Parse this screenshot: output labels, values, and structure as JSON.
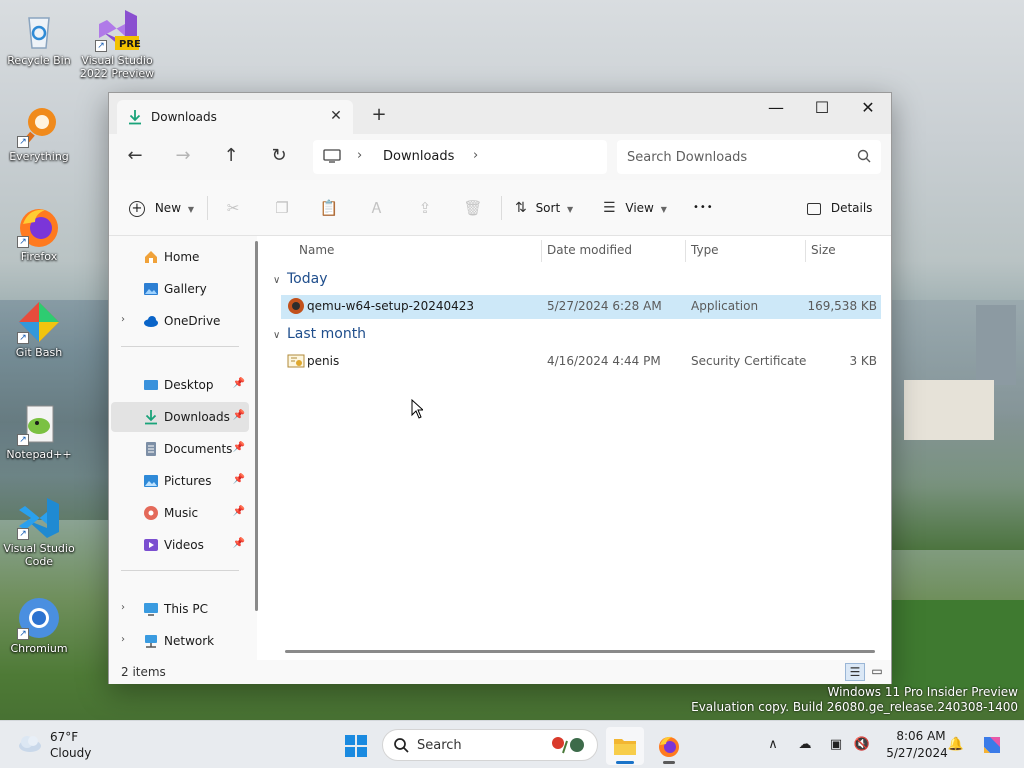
{
  "desktop": {
    "icons": [
      {
        "label": "Recycle Bin",
        "icon": "recycle-bin-icon"
      },
      {
        "label": "Visual Studio 2022 Preview",
        "line1": "Visual Studio",
        "line2": "2022 Preview",
        "badge": "PRE",
        "icon": "visual-studio-icon"
      },
      {
        "label": "Everything",
        "icon": "everything-search-icon"
      },
      {
        "label": "Firefox",
        "icon": "firefox-icon"
      },
      {
        "label": "Git Bash",
        "icon": "git-bash-icon"
      },
      {
        "label": "Notepad++",
        "icon": "notepad-plus-plus-icon"
      },
      {
        "label": "Visual Studio Code",
        "line1": "Visual Studio",
        "line2": "Code",
        "icon": "vscode-icon"
      },
      {
        "label": "Chromium",
        "icon": "chromium-icon"
      }
    ]
  },
  "window": {
    "tab": {
      "title": "Downloads",
      "close": "✕"
    },
    "new_tab": "+",
    "controls": {
      "minimize": "—",
      "maximize": "☐",
      "close": "✕"
    },
    "nav": {
      "back": "←",
      "forward": "→",
      "up": "↑",
      "refresh": "↻"
    },
    "address": {
      "path": "Downloads",
      "chevron": "›"
    },
    "search": {
      "placeholder": "Search Downloads"
    },
    "toolbar": {
      "new": "New",
      "sort": "Sort",
      "view": "View",
      "more": "•••",
      "details": "Details"
    },
    "sidebar": {
      "items": [
        {
          "label": "Home",
          "icon": "home-icon"
        },
        {
          "label": "Gallery",
          "icon": "gallery-icon"
        },
        {
          "label": "OneDrive",
          "icon": "onedrive-icon"
        },
        {
          "label": "Desktop",
          "icon": "desktop-folder-icon"
        },
        {
          "label": "Downloads",
          "icon": "downloads-folder-icon"
        },
        {
          "label": "Documents",
          "icon": "documents-folder-icon"
        },
        {
          "label": "Pictures",
          "icon": "pictures-folder-icon"
        },
        {
          "label": "Music",
          "icon": "music-folder-icon"
        },
        {
          "label": "Videos",
          "icon": "videos-folder-icon"
        },
        {
          "label": "This PC",
          "icon": "this-pc-icon"
        },
        {
          "label": "Network",
          "icon": "network-icon"
        }
      ]
    },
    "columns": [
      "Name",
      "Date modified",
      "Type",
      "Size"
    ],
    "groups": [
      {
        "label": "Today",
        "files": [
          {
            "name": "qemu-w64-setup-20240423",
            "date": "5/27/2024 6:28 AM",
            "type": "Application",
            "size": "169,538 KB",
            "icon": "qemu-installer-icon"
          }
        ]
      },
      {
        "label": "Last month",
        "files": [
          {
            "name": "penis",
            "date": "4/16/2024 4:44 PM",
            "type": "Security Certificate",
            "size": "3 KB",
            "icon": "certificate-icon"
          }
        ]
      }
    ],
    "status": {
      "count": "2 items"
    }
  },
  "watermark": {
    "line1": "Windows 11 Pro Insider Preview",
    "line2": "Evaluation copy. Build 26080.ge_release.240308-1400"
  },
  "taskbar": {
    "weather": {
      "temp": "67°F",
      "condition": "Cloudy"
    },
    "search_placeholder": "Search",
    "clock": {
      "time": "8:06 AM",
      "date": "5/27/2024"
    }
  },
  "colors": {
    "accent": "#1a73c8",
    "selection": "#cde8f8",
    "group_header": "#1f4e8c"
  }
}
